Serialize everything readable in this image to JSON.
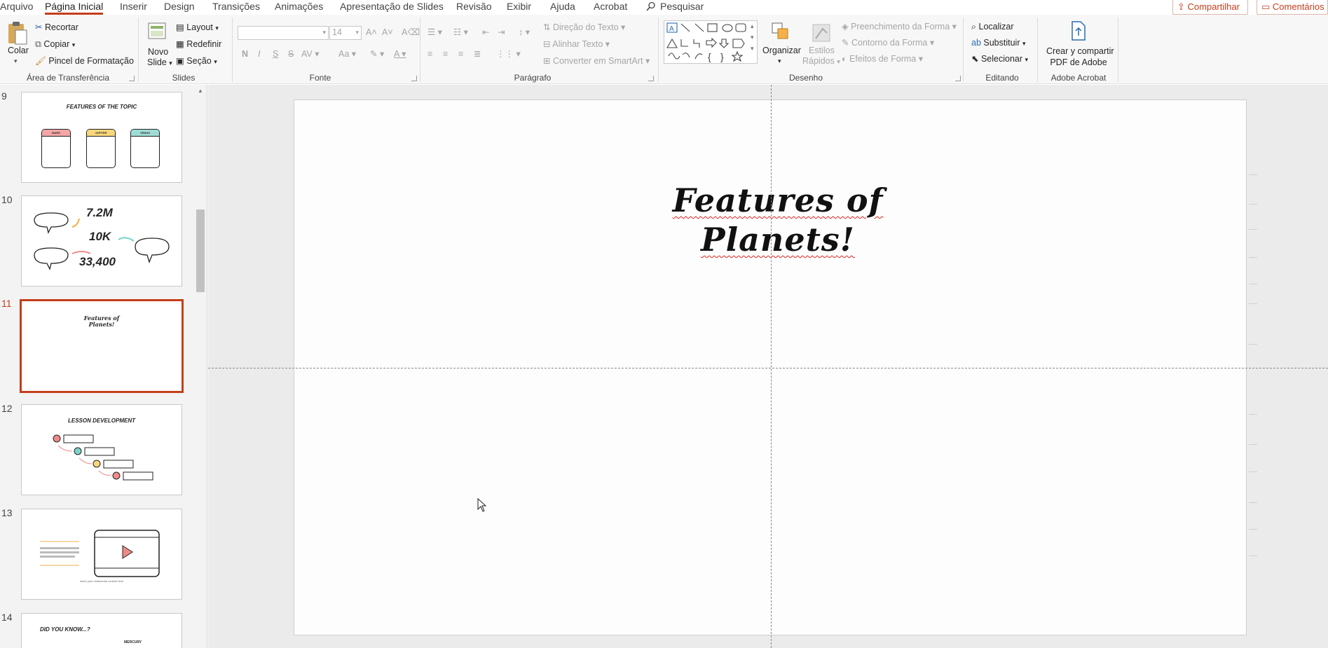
{
  "menu": {
    "tabs": [
      "Arquivo",
      "Página Inicial",
      "Inserir",
      "Design",
      "Transições",
      "Animações",
      "Apresentação de Slides",
      "Revisão",
      "Exibir",
      "Ajuda",
      "Acrobat"
    ],
    "active_tab": "Página Inicial",
    "search": "Pesquisar",
    "share": "Compartilhar",
    "comments": "Comentários"
  },
  "ribbon": {
    "clipboard": {
      "paste": "Colar",
      "cut": "Recortar",
      "copy": "Copiar",
      "format_painter": "Pincel de Formatação",
      "label": "Área de Transferência"
    },
    "slides": {
      "new_slide_1": "Novo",
      "new_slide_2": "Slide",
      "layout": "Layout",
      "reset": "Redefinir",
      "section": "Seção",
      "label": "Slides"
    },
    "font": {
      "font_name": "",
      "font_size": "14",
      "label": "Fonte"
    },
    "paragraph": {
      "text_direction": "Direção do Texto",
      "align_text": "Alinhar Texto",
      "smartart": "Converter em SmartArt",
      "label": "Parágrafo"
    },
    "drawing": {
      "organize": "Organizar",
      "quick_styles_1": "Estilos",
      "quick_styles_2": "Rápidos",
      "shape_fill": "Preenchimento da Forma",
      "shape_outline": "Contorno da Forma",
      "shape_effects": "Efeitos de Forma",
      "label": "Desenho"
    },
    "editing": {
      "find": "Localizar",
      "replace": "Substituir",
      "select": "Selecionar",
      "label": "Editando"
    },
    "acrobat": {
      "create_1": "Crear y compartir",
      "create_2": "PDF de Adobe",
      "label": "Adobe Acrobat"
    }
  },
  "thumbnails": [
    {
      "num": "9",
      "title": "FEATURES OF THE TOPIC",
      "cards": [
        "MARS",
        "JUPITER",
        "VENUS"
      ]
    },
    {
      "num": "10",
      "stats": [
        "7.2M",
        "10K",
        "33,400"
      ]
    },
    {
      "num": "11",
      "title1": "Features of",
      "title2": "Planets!"
    },
    {
      "num": "12",
      "title": "LESSON DEVELOPMENT"
    },
    {
      "num": "13",
      "caption": "Insert your multimedia content here"
    },
    {
      "num": "14",
      "title": "DID YOU KNOW...?",
      "tag": "MERCURY"
    }
  ],
  "selected_slide": "11",
  "slide": {
    "title_line1": "Features of",
    "title_line2": "Planets!"
  },
  "colors": {
    "accent": "#c43e1c",
    "mars": "#f4a6a6",
    "jupiter": "#f8d77c",
    "venus": "#9fdcd6"
  }
}
